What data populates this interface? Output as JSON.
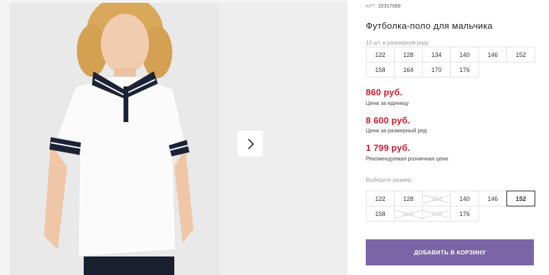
{
  "product": {
    "sku_label": "АРТ:",
    "sku_value": "22317069",
    "title": "Футболка-поло для мальчика",
    "pack_note": "10 шт. в размерном ряду",
    "pack_sizes": [
      "122",
      "128",
      "134",
      "140",
      "146",
      "152",
      "158",
      "164",
      "170",
      "176"
    ]
  },
  "prices": {
    "unit_price": "860 руб.",
    "unit_label": "Цена за единицу",
    "pack_price": "8 600 руб.",
    "pack_label": "Цена за размерный ряд",
    "retail_price": "1 799 руб.",
    "retail_label": "Рекомендуемая розничная цена"
  },
  "size_picker": {
    "label": "Выберите размер:",
    "sizes": [
      {
        "value": "122",
        "state": "available"
      },
      {
        "value": "128",
        "state": "available"
      },
      {
        "value": "134",
        "state": "unavailable"
      },
      {
        "value": "140",
        "state": "available"
      },
      {
        "value": "146",
        "state": "available"
      },
      {
        "value": "152",
        "state": "selected"
      },
      {
        "value": "158",
        "state": "available"
      },
      {
        "value": "164",
        "state": "unavailable"
      },
      {
        "value": "170",
        "state": "unavailable"
      },
      {
        "value": "176",
        "state": "available"
      }
    ]
  },
  "cart": {
    "button_label": "Добавить в корзину"
  },
  "colors": {
    "price": "#d11a2a",
    "button": "#7b65a6"
  },
  "icons": {
    "next": "chevron-right-icon"
  }
}
